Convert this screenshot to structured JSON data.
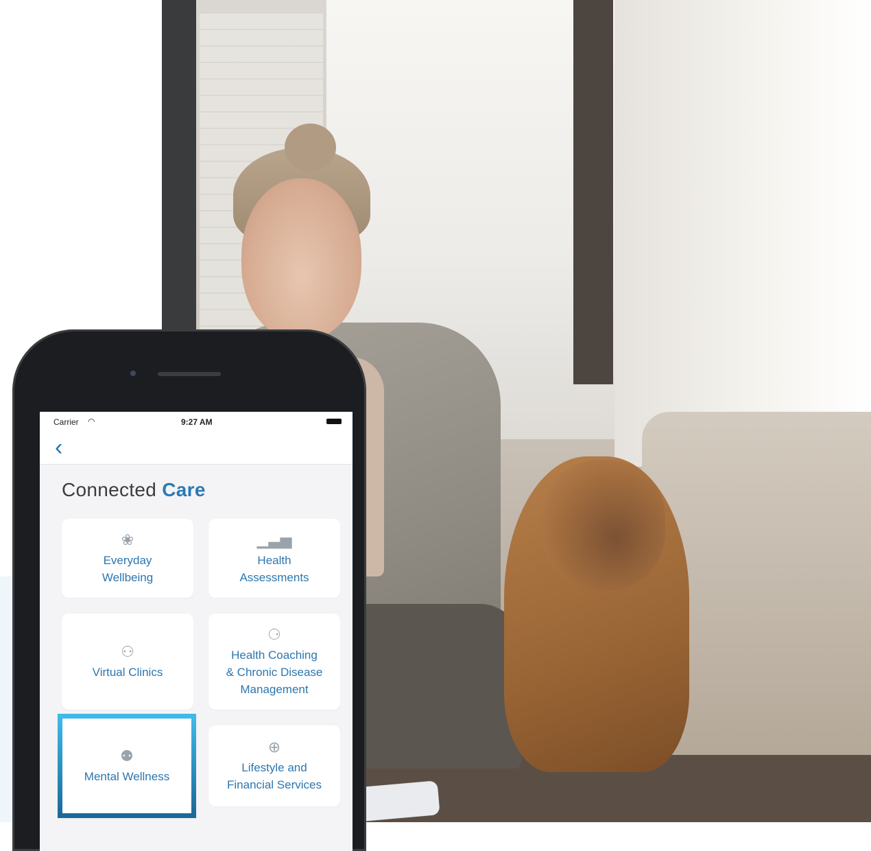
{
  "status_bar": {
    "carrier": "Carrier",
    "time": "9:27 AM"
  },
  "app": {
    "title_prefix": "Connected",
    "title_accent": "Care"
  },
  "tiles": [
    {
      "label": "Everyday\nWellbeing",
      "icon": "lotus-icon"
    },
    {
      "label": "Health\nAssessments",
      "icon": "bar-chart-icon"
    },
    {
      "label": "Virtual Clinics",
      "icon": "doctor-icon"
    },
    {
      "label": "Health Coaching\n& Chronic Disease\nManagement",
      "icon": "coach-icon"
    },
    {
      "label": "Mental Wellness",
      "icon": "brain-icon",
      "highlighted": true
    },
    {
      "label": "Lifestyle and\nFinancial Services",
      "icon": "plus-circle-icon"
    }
  ],
  "colors": {
    "accent": "#2b79b6",
    "highlight_top": "#3fb8ea",
    "highlight_bottom": "#1c6a99",
    "screen_bg": "#f4f4f6"
  }
}
